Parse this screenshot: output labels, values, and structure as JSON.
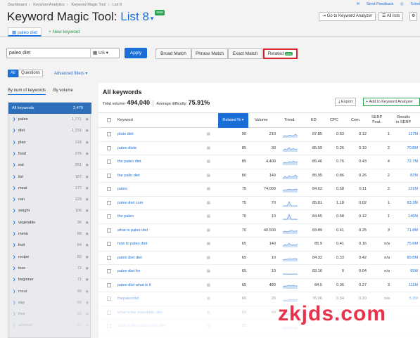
{
  "breadcrumb": [
    "Dashboard",
    "Keyword Analytics",
    "Keyword Magic Tool",
    "List 8"
  ],
  "top_links": {
    "feedback": "Send Feedback",
    "tutorial": "Tutori"
  },
  "header": {
    "title_prefix": "Keyword Magic Tool:",
    "list_name": "List 8",
    "badge": "new",
    "go_to_ka": "Go to Keyword Analyzer",
    "all_lists": "All lists"
  },
  "tabs": {
    "current": "paleo diet",
    "new": "+ New keyword"
  },
  "search": {
    "value": "paleo diet",
    "country": "US",
    "apply": "Apply"
  },
  "match": {
    "broad": "Broad Match",
    "phrase": "Phrase Match",
    "exact": "Exact Match",
    "related": "Related",
    "related_badge": "new"
  },
  "filters": {
    "all": "All",
    "questions": "Questions",
    "advanced": "Advanced filters"
  },
  "left": {
    "tab_count": "By num of keywords",
    "tab_volume": "By volume",
    "all_label": "All keywords",
    "all_count": "2,470",
    "groups": [
      {
        "word": "paleo",
        "count": "1,771"
      },
      {
        "word": "diet",
        "count": "1,331"
      },
      {
        "word": "plan",
        "count": "318"
      },
      {
        "word": "food",
        "count": "276"
      },
      {
        "word": "eat",
        "count": "261"
      },
      {
        "word": "list",
        "count": "187"
      },
      {
        "word": "meal",
        "count": "177"
      },
      {
        "word": "can",
        "count": "129"
      },
      {
        "word": "weight",
        "count": "106"
      },
      {
        "word": "vegetable",
        "count": "96"
      },
      {
        "word": "menu",
        "count": "89"
      },
      {
        "word": "fruit",
        "count": "84"
      },
      {
        "word": "recipe",
        "count": "82"
      },
      {
        "word": "loss",
        "count": "72"
      },
      {
        "word": "beginner",
        "count": "71"
      },
      {
        "word": "meat",
        "count": "68"
      },
      {
        "word": "day",
        "count": "66"
      },
      {
        "word": "free",
        "count": "62"
      },
      {
        "word": "allowed",
        "count": "60"
      }
    ]
  },
  "main": {
    "title": "All keywords",
    "total_volume_label": "Total volume:",
    "total_volume": "494,040",
    "avg_difficulty_label": "Average difficulty:",
    "avg_difficulty": "75.91%",
    "export": "Export",
    "add_to_ka": "+ Add to Keyword Analyzer",
    "columns": {
      "keyword": "Keyword",
      "related": "Related %",
      "volume": "Volume",
      "trend": "Trend",
      "kd": "KD",
      "cpc": "CPC",
      "com": "Com.",
      "serp_l1": "SERP",
      "serp_l2": "Feat.",
      "res_l1": "Results",
      "res_l2": "in SERP"
    },
    "rows": [
      {
        "keyword": "plato diet",
        "related": "90",
        "volume": "210",
        "kd": "87.85",
        "cpc": "0.63",
        "com": "0.12",
        "serp": "1",
        "results": "117M"
      },
      {
        "keyword": "paleo diete",
        "related": "85",
        "volume": "30",
        "kd": "85.59",
        "cpc": "0.26",
        "com": "0.19",
        "serp": "2",
        "results": "70.8M"
      },
      {
        "keyword": "the paleo diet",
        "related": "85",
        "volume": "4,400",
        "kd": "85.46",
        "cpc": "0.76",
        "com": "0.43",
        "serp": "4",
        "results": "72.7M"
      },
      {
        "keyword": "the pailo diet",
        "related": "80",
        "volume": "140",
        "kd": "85.95",
        "cpc": "0.86",
        "com": "0.26",
        "serp": "2",
        "results": "82M"
      },
      {
        "keyword": "paleo",
        "related": "75",
        "volume": "74,000",
        "kd": "84.62",
        "cpc": "0.58",
        "com": "0.11",
        "serp": "2",
        "results": "131M"
      },
      {
        "keyword": "paleo diet com",
        "related": "75",
        "volume": "70",
        "kd": "85.81",
        "cpc": "1.18",
        "com": "0.02",
        "serp": "1",
        "results": "83.3M"
      },
      {
        "keyword": "the paleo",
        "related": "70",
        "volume": "10",
        "kd": "84.55",
        "cpc": "0.58",
        "com": "0.12",
        "serp": "1",
        "results": "146M"
      },
      {
        "keyword": "what is paleo diet",
        "related": "70",
        "volume": "40,500",
        "kd": "83.89",
        "cpc": "0.41",
        "com": "0.25",
        "serp": "3",
        "results": "71.8M"
      },
      {
        "keyword": "how to paleo diet",
        "related": "65",
        "volume": "140",
        "kd": "85.9",
        "cpc": "0.41",
        "com": "0.16",
        "serp": "n/a",
        "results": "75.6M"
      },
      {
        "keyword": "paleo diet diet",
        "related": "65",
        "volume": "10",
        "kd": "84.32",
        "cpc": "0.33",
        "com": "0.42",
        "serp": "n/a",
        "results": "89.8M"
      },
      {
        "keyword": "paleo diet for",
        "related": "65",
        "volume": "10",
        "kd": "83.16",
        "cpc": "0",
        "com": "0.04",
        "serp": "n/a",
        "results": "95M"
      },
      {
        "keyword": "paleo diet what is it",
        "related": "65",
        "volume": "480",
        "kd": "84.5",
        "cpc": "0.36",
        "com": "0.27",
        "serp": "3",
        "results": "111M"
      },
      {
        "keyword": "thepaleodiet",
        "related": "60",
        "volume": "20",
        "kd": "76.06",
        "cpc": "0.34",
        "com": "0.20",
        "serp": "n/a",
        "results": "5.3M"
      },
      {
        "keyword": "what is the paleolithic diet",
        "related": "60",
        "volume": "40",
        "kd": "",
        "cpc": "",
        "com": "",
        "serp": "",
        "results": ""
      },
      {
        "keyword": "what is the paleo of the diet",
        "related": "55",
        "volume": "",
        "kd": "",
        "cpc": "",
        "com": "",
        "serp": "",
        "results": ""
      }
    ]
  },
  "watermark": "zkjds.com",
  "colors": {
    "accent": "#1a6fd6",
    "highlight_border": "#d9252e",
    "green": "#2aa44f",
    "left_head": "#2d6fb8"
  }
}
